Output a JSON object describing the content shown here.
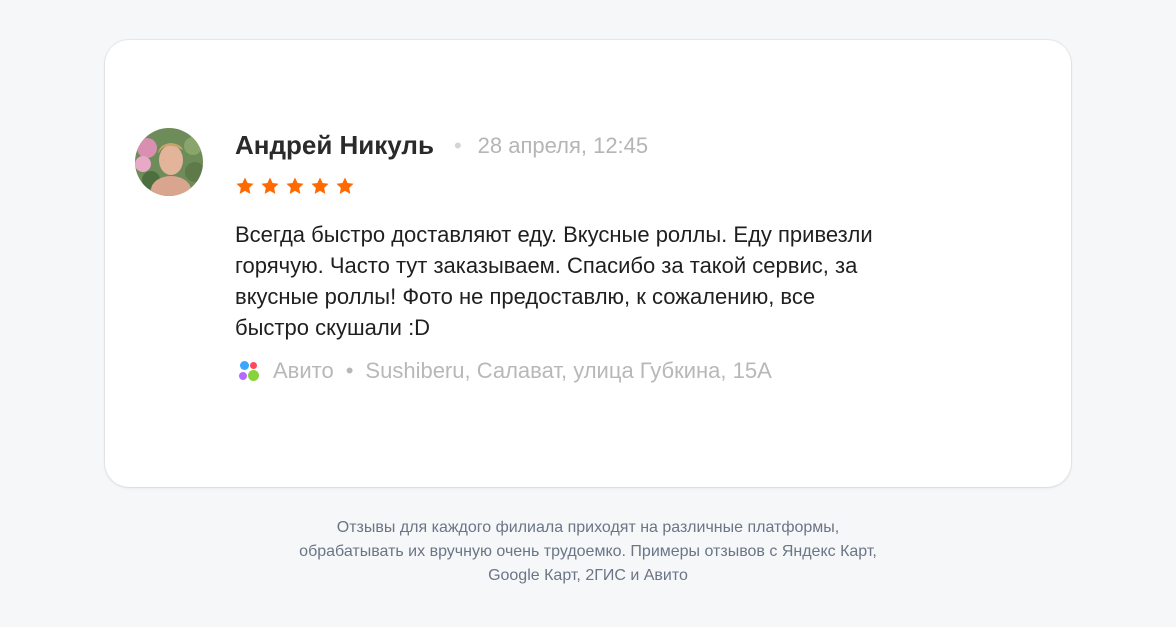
{
  "review": {
    "author": "Андрей Никуль",
    "separator": "•",
    "date": "28 апреля, 12:45",
    "rating": 5,
    "text": "Всегда быстро доставляют еду. Вкусные роллы. Еду привезли горячую. Часто тут заказываем. Спасибо за такой сервис, за вкусные роллы! Фото не предоставлю, к сожалению, все быстро скушали :D",
    "source_icon": "avito-icon",
    "source": "Авито",
    "location": "Sushiberu, Салават, улица Губкина, 15А"
  },
  "caption": {
    "line1": "Отзывы для каждого филиала приходят на различные платформы,",
    "line2": "обрабатывать их вручную очень трудоемко. Примеры отзывов с Яндекс Карт,",
    "line3": "Google Карт, 2ГИС и Авито"
  },
  "colors": {
    "star": "#ff6a00",
    "background": "#f6f7f9",
    "card": "#ffffff"
  }
}
